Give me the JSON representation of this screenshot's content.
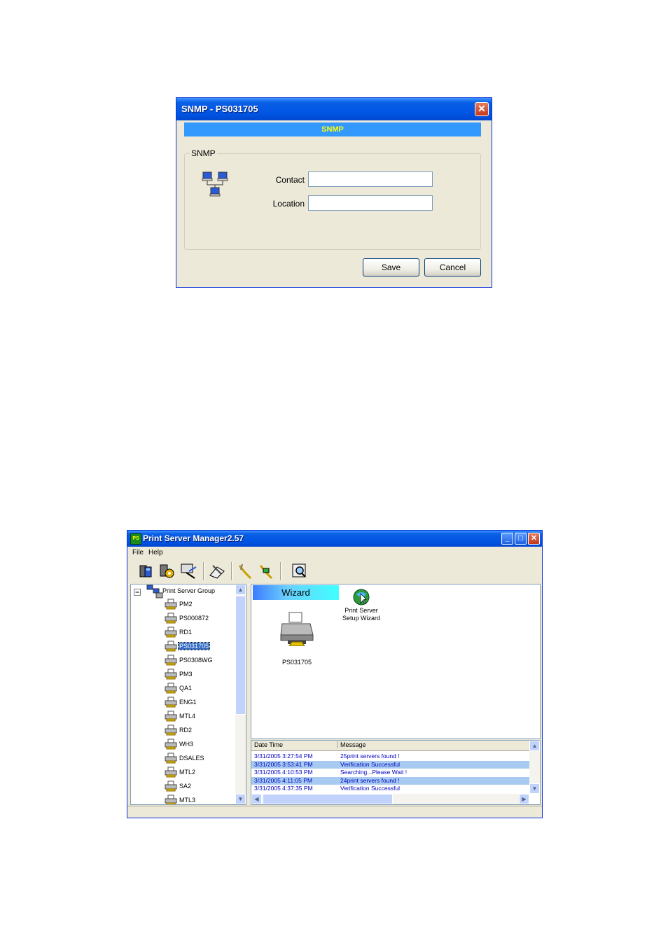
{
  "snmp_dialog": {
    "title": "SNMP - PS031705",
    "banner": "SNMP",
    "group_label": "SNMP",
    "contact_label": "Contact",
    "contact_value": "",
    "location_label": "Location",
    "location_value": "",
    "save_label": "Save",
    "cancel_label": "Cancel"
  },
  "manager_window": {
    "title": "Print Server Manager2.57",
    "menu": [
      "File",
      "Help"
    ],
    "toolbar_icons": [
      "server-icon",
      "configure-icon",
      "search-network-icon",
      "edit-icon",
      "connect-icon",
      "disconnect-icon",
      "find-icon"
    ],
    "tree": {
      "root": "Print Server Group",
      "items": [
        "PM2",
        "PS000872",
        "RD1",
        "PS031705",
        "PS0308WG",
        "PM3",
        "QA1",
        "ENG1",
        "MTL4",
        "RD2",
        "WH3",
        "DSALES",
        "MTL2",
        "SA2",
        "MTL3"
      ],
      "selected": "PS031705"
    },
    "wizard_tab": "Wizard",
    "wizard_icon_label_line1": "Print Server",
    "wizard_icon_label_line2": "Setup Wizard",
    "printer_label": "PS031705",
    "log": {
      "columns": [
        "Date Time",
        "Message"
      ],
      "rows": [
        {
          "time": "3/31/2005 3:27:54 PM",
          "message": "25print servers found !"
        },
        {
          "time": "3/31/2005 3:53:41 PM",
          "message": "Verification Successful"
        },
        {
          "time": "3/31/2005 4:10:53 PM",
          "message": "Searching...Please Wait !"
        },
        {
          "time": "3/31/2005 4:11:05 PM",
          "message": "24print servers found !"
        },
        {
          "time": "3/31/2005 4:37:35 PM",
          "message": "Verification Successful"
        }
      ]
    }
  }
}
